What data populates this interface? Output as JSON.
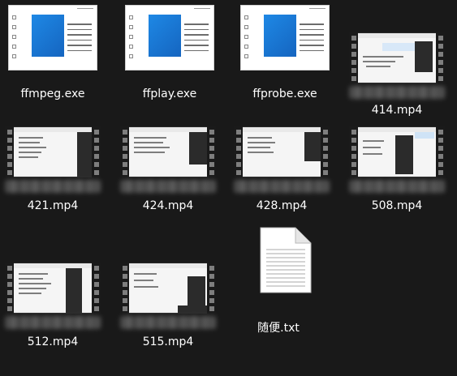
{
  "files": [
    {
      "name": "ffmpeg.exe",
      "kind": "exe"
    },
    {
      "name": "ffplay.exe",
      "kind": "exe"
    },
    {
      "name": "ffprobe.exe",
      "kind": "exe"
    },
    {
      "name": "414.mp4",
      "kind": "video"
    },
    {
      "name": "421.mp4",
      "kind": "video"
    },
    {
      "name": "424.mp4",
      "kind": "video"
    },
    {
      "name": "428.mp4",
      "kind": "video"
    },
    {
      "name": "508.mp4",
      "kind": "video"
    },
    {
      "name": "512.mp4",
      "kind": "video"
    },
    {
      "name": "515.mp4",
      "kind": "video"
    },
    {
      "name": "随便.txt",
      "kind": "txt"
    }
  ],
  "colors": {
    "background": "#191919",
    "label": "#ffffff",
    "exe_icon_blue": "#1e88e5"
  },
  "icons": {
    "exe": "application-window-icon",
    "video": "film-strip-icon",
    "txt": "text-document-icon"
  }
}
